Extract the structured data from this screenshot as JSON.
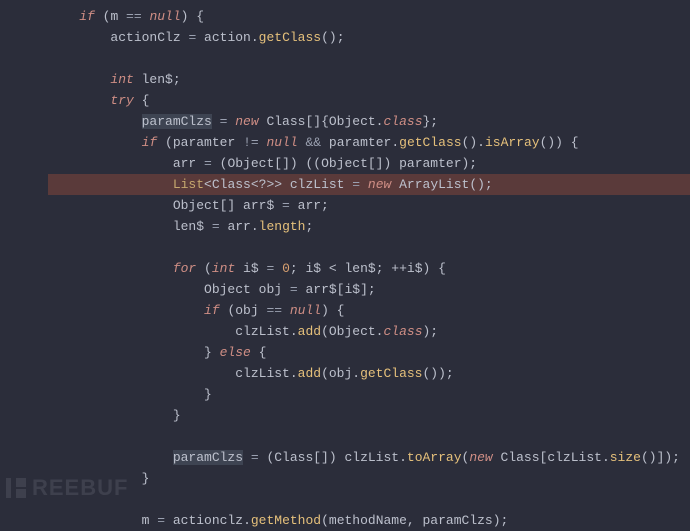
{
  "code": {
    "l1_if": "if",
    "l1_paren_o": " (",
    "l1_m": "m ",
    "l1_eq": "== ",
    "l1_null": "null",
    "l1_paren_c": ") {",
    "l2_actionClz": "actionClz ",
    "l2_eq": "= ",
    "l2_action": "action",
    "l2_dot": ".",
    "l2_getClass": "getClass",
    "l2_end": "();",
    "l4_int": "int",
    "l4_len": " len$;",
    "l5_try": "try",
    "l5_brace": " {",
    "l6_paramClzs": "paramClzs",
    "l6_eq": " = ",
    "l6_new": "new",
    "l6_class": " Class[]{Object.",
    "l6_classw": "class",
    "l6_end": "};",
    "l7_if": "if",
    "l7_po": " (",
    "l7_par1": "paramter ",
    "l7_ne": "!= ",
    "l7_null": "null",
    "l7_and": " && ",
    "l7_par2": "paramter",
    "l7_dot": ".",
    "l7_getClass": "getClass",
    "l7_mid": "().",
    "l7_isArray": "isArray",
    "l7_end": "()) {",
    "l8_arr": "arr ",
    "l8_eq": "= ",
    "l8_cast1": "(Object[]) ((Object[]) paramter);",
    "l9_list": "List",
    "l9_gen": "<Class<?>> ",
    "l9_clzList": "clzList ",
    "l9_eq": "= ",
    "l9_new": "new",
    "l9_al": " ArrayList();",
    "l10_obj": "Object[] arr$ ",
    "l10_eq": "= ",
    "l10_arr": "arr;",
    "l11_len": "len$ ",
    "l11_eq": "= ",
    "l11_arr": "arr",
    "l11_dot": ".",
    "l11_length": "length",
    "l11_end": ";",
    "l13_for": "for",
    "l13_po": " (",
    "l13_int": "int",
    "l13_i": " i$ ",
    "l13_eq": "= ",
    "l13_zero": "0",
    "l13_sc": "; i$ < len$; ++i$) {",
    "l14_obj": "Object obj ",
    "l14_eq": "= ",
    "l14_arr": "arr$[i$];",
    "l15_if": "if",
    "l15_po": " (obj ",
    "l15_eq": "== ",
    "l15_null": "null",
    "l15_end": ") {",
    "l16_clzList": "clzList",
    "l16_dot": ".",
    "l16_add": "add",
    "l16_po": "(Object.",
    "l16_class": "class",
    "l16_end": ");",
    "l17_brace": "} ",
    "l17_else": "else",
    "l17_end": " {",
    "l18_clzList": "clzList",
    "l18_dot": ".",
    "l18_add": "add",
    "l18_po": "(obj.",
    "l18_getClass": "getClass",
    "l18_end": "());",
    "l19_brace": "}",
    "l20_brace": "}",
    "l22_paramClzs": "paramClzs",
    "l22_eq": " = ",
    "l22_cast": "(Class[]) clzList",
    "l22_dot": ".",
    "l22_toArray": "toArray",
    "l22_po": "(",
    "l22_new": "new",
    "l22_cls": " Class[clzList",
    "l22_dot2": ".",
    "l22_size": "size",
    "l22_end": "()]);",
    "l23_brace": "}",
    "l25_m": "m ",
    "l25_eq": "= ",
    "l25_actionclz": "actionclz",
    "l25_dot": ".",
    "l25_getMethod": "getMethod",
    "l25_end": "(methodName, paramClzs);"
  },
  "watermark": "REEBUF"
}
